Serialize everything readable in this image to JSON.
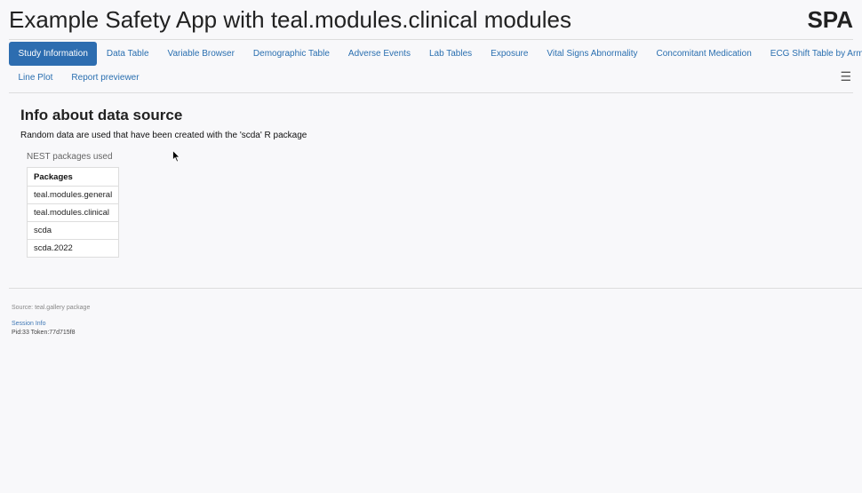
{
  "app": {
    "title": "Example Safety App with teal.modules.clinical modules",
    "abbr": "SPA"
  },
  "tabs_row1": [
    {
      "label": "Study Information",
      "active": true
    },
    {
      "label": "Data Table"
    },
    {
      "label": "Variable Browser"
    },
    {
      "label": "Demographic Table"
    },
    {
      "label": "Adverse Events"
    },
    {
      "label": "Lab Tables"
    },
    {
      "label": "Exposure"
    },
    {
      "label": "Vital Signs Abnormality"
    },
    {
      "label": "Concomitant Medication"
    },
    {
      "label": "ECG Shift Table by Arm"
    }
  ],
  "tabs_row2": [
    {
      "label": "Line Plot"
    },
    {
      "label": "Report previewer"
    }
  ],
  "menu_icon": "hamburger-menu-icon",
  "info": {
    "title": "Info about data source",
    "description": "Random data are used that have been created with the 'scda' R package"
  },
  "packages_table": {
    "caption": "NEST packages used",
    "header": "Packages",
    "rows": [
      "teal.modules.general",
      "teal.modules.clinical",
      "scda",
      "scda.2022"
    ]
  },
  "footer": {
    "source": "Source: teal.gallery package",
    "session_link": "Session Info",
    "pid_token": "Pid:33 Token:77d715f8"
  },
  "colors": {
    "accent": "#2d6db0",
    "link": "#2a6fb0",
    "background": "#f8f8fa"
  }
}
